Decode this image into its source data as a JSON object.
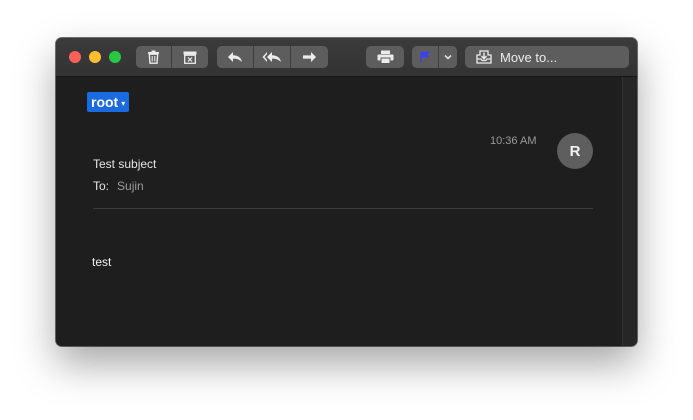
{
  "toolbar": {
    "delete_icon": "trash-icon",
    "junk_icon": "junk-icon",
    "reply_icon": "reply-icon",
    "reply_all_icon": "reply-all-icon",
    "forward_icon": "forward-icon",
    "print_icon": "printer-icon",
    "flag_icon": "flag-icon",
    "flag_color": "#3a3ff0",
    "move_icon": "move-tray-icon",
    "move_label": "Move to..."
  },
  "message": {
    "sender": "root",
    "subject": "Test subject",
    "to_label": "To:",
    "to_value": "Sujin",
    "time": "10:36 AM",
    "avatar_initial": "R",
    "body": "test"
  },
  "colors": {
    "sender_chip": "#1a6ae0",
    "close": "#fe5f57",
    "minimize": "#febc2e",
    "maximize": "#28c840"
  }
}
